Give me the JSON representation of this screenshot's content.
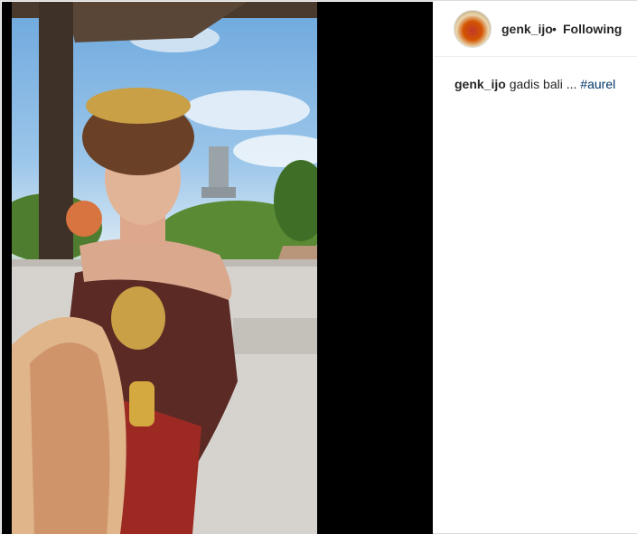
{
  "post": {
    "username": "genk_ijo",
    "separator": "•",
    "follow_status": "Following",
    "caption": {
      "username": "genk_ijo",
      "text": "gadis bali ...",
      "hashtag": "#aurel"
    }
  },
  "icons": {
    "avatar": "profile-avatar"
  },
  "colors": {
    "text": "#262626",
    "hashtag": "#003569",
    "border": "#dbdbdb",
    "media_background": "#000000"
  }
}
